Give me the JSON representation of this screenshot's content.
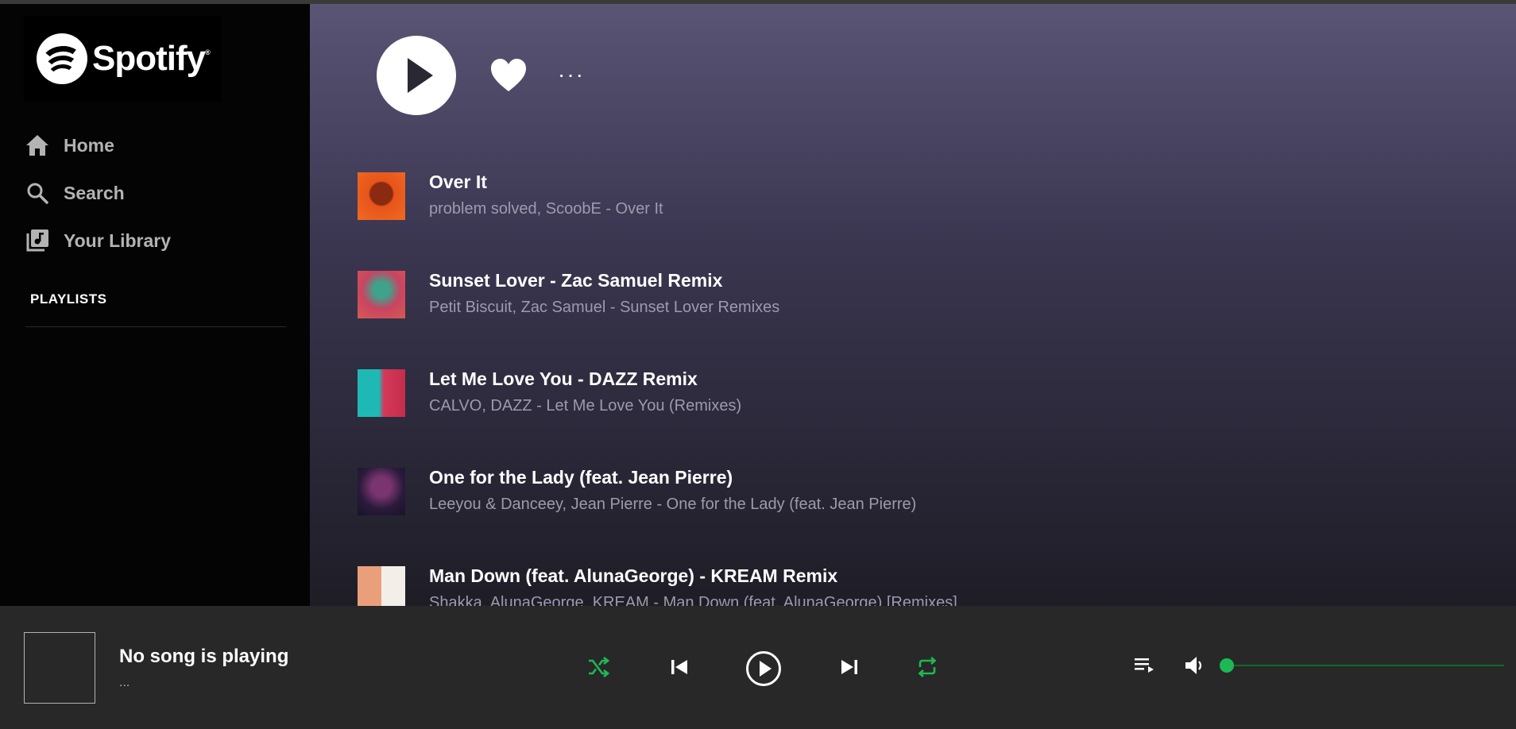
{
  "app": {
    "brand": "Spotify",
    "trademark": "®",
    "colors": {
      "accent": "#1db954",
      "sidebar": "#040404",
      "player": "#282828",
      "muted_text": "#b3b3b3"
    }
  },
  "sidebar": {
    "nav": [
      {
        "label": "Home",
        "icon": "home-icon"
      },
      {
        "label": "Search",
        "icon": "search-icon"
      },
      {
        "label": "Your Library",
        "icon": "library-icon"
      }
    ],
    "playlists_heading": "PLAYLISTS"
  },
  "main": {
    "actions": {
      "play": "play-icon",
      "like": "heart-icon",
      "more": "···"
    },
    "tracks": [
      {
        "title": "Over It",
        "subtitle": "problem solved, ScoobE - Over It"
      },
      {
        "title": "Sunset Lover - Zac Samuel Remix",
        "subtitle": "Petit Biscuit, Zac Samuel - Sunset Lover Remixes"
      },
      {
        "title": "Let Me Love You - DAZZ Remix",
        "subtitle": "CALVO, DAZZ - Let Me Love You (Remixes)"
      },
      {
        "title": "One for the Lady (feat. Jean Pierre)",
        "subtitle": "Leeyou & Danceey, Jean Pierre - One for the Lady (feat. Jean Pierre)"
      },
      {
        "title": "Man Down (feat. AlunaGeorge) - KREAM Remix",
        "subtitle": "Shakka, AlunaGeorge, KREAM - Man Down (feat. AlunaGeorge) [Remixes]"
      }
    ]
  },
  "player": {
    "now_playing_title": "No song is playing",
    "now_playing_subtitle": "...",
    "controls": [
      "shuffle-icon",
      "previous-icon",
      "play-icon",
      "next-icon",
      "repeat-icon"
    ],
    "volume_level": 0.0
  }
}
